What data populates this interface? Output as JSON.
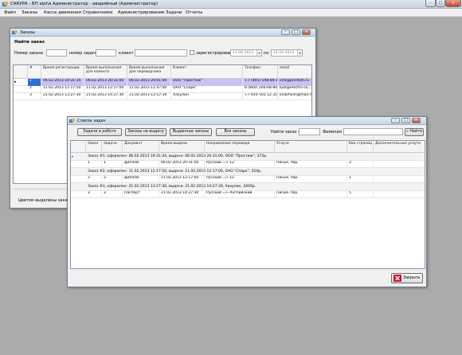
{
  "window": {
    "title": "САКУРА - БП alpha    Администратор - аварийный (Администратор)",
    "controls": [
      "–",
      "□",
      "✕"
    ]
  },
  "menu": [
    "Файл",
    "Заказы",
    "Касса движения",
    "Справочники",
    "Администрирование",
    "Задачи",
    "Отчеты"
  ],
  "orders_window": {
    "title": "Заказы",
    "find_heading": "Найти заказ",
    "labels": {
      "order_no": "Номер заказа",
      "task_no": "номер задачи",
      "client": "клиент",
      "registered_from": "зарегистрирован с",
      "to": "по"
    },
    "date_from": "11.06.2013",
    "date_to": "14.06.2013",
    "columns": [
      "#",
      "Время регистрации",
      "Время выполнения для клиента",
      "Время выполнения для переводчика",
      "Клиент",
      "Телефон",
      "email"
    ],
    "rows": [
      [
        "1",
        "06.02.2013 19:31:34",
        "06.02.2013 20:31:00",
        "06.02.2013 20:01:00",
        "ООО \"Престиж\"",
        "+7 (495) 598-89-12",
        "info@prestizh.ru"
      ],
      [
        "2",
        "11.02.2013 11:17:50",
        "11.02.2013 12:17:00",
        "11.02.2013 11:47:00",
        "ОАО \"Спарк\"",
        "8 (800) 200-68-80",
        "b2b@electro-co..."
      ],
      [
        "3",
        "21.02.2013 13:27:30",
        "21.02.2013 14:27:30",
        "21.02.2013 13:57:30",
        "Хахулин",
        "+7 910 503 12 35",
        "khakhulin@mail.ru"
      ]
    ],
    "footer_text": "Цветом выделены заказы"
  },
  "tasks_window": {
    "title": "Список задач",
    "filter_buttons": [
      "Задачи в работе",
      "Заказы на выдачу",
      "Выданные заказы",
      "Все заказы"
    ],
    "find_label": "Найти заказ #",
    "surname_label": "Фамилия",
    "find_button": "Найти",
    "columns": [
      "Заказ",
      "Задача",
      "Документ",
      "Время выдачи",
      "Направление перевода",
      "Услуги",
      "Кво страниц",
      "Дополнительные услуги"
    ],
    "groups": [
      {
        "header": "Заказ #1, оформлен: 06.02.2013 19:31:34, выдача: 06.02.2013 20:31:00, ООО \"Престиж\", 372р.",
        "task": [
          "1",
          "1",
          "Диплом",
          "06.02.2013 20:31:00",
          "Русский => 12",
          "Письм. пер.",
          "3",
          ""
        ]
      },
      {
        "header": "Заказ #2, оформлен: 11.02.2013 11:17:50, выдача: 11.02.2013 12:17:00, ОАО \"Спарк\", 324р.",
        "task": [
          "2",
          "2",
          "Диплом",
          "11.02.2013 12:17:00",
          "Русский => 12",
          "Письм. пер.",
          "1",
          ""
        ]
      },
      {
        "header": "Заказ #3, оформлен: 21.02.2013 13:27:30, выдача: 21.02.2013 14:27:30, Хахулин, 2400р.",
        "task": [
          "3",
          "3",
          "Паспорт",
          "21.02.2013 14:27:30",
          "Русский => Английский",
          "Письм. пер.",
          "5",
          ""
        ]
      }
    ],
    "close_button": "Закрыть"
  },
  "colors": {
    "selected_row": "#c9c2f2",
    "desktop": "#ababab",
    "close_icon": "#c8102e"
  }
}
